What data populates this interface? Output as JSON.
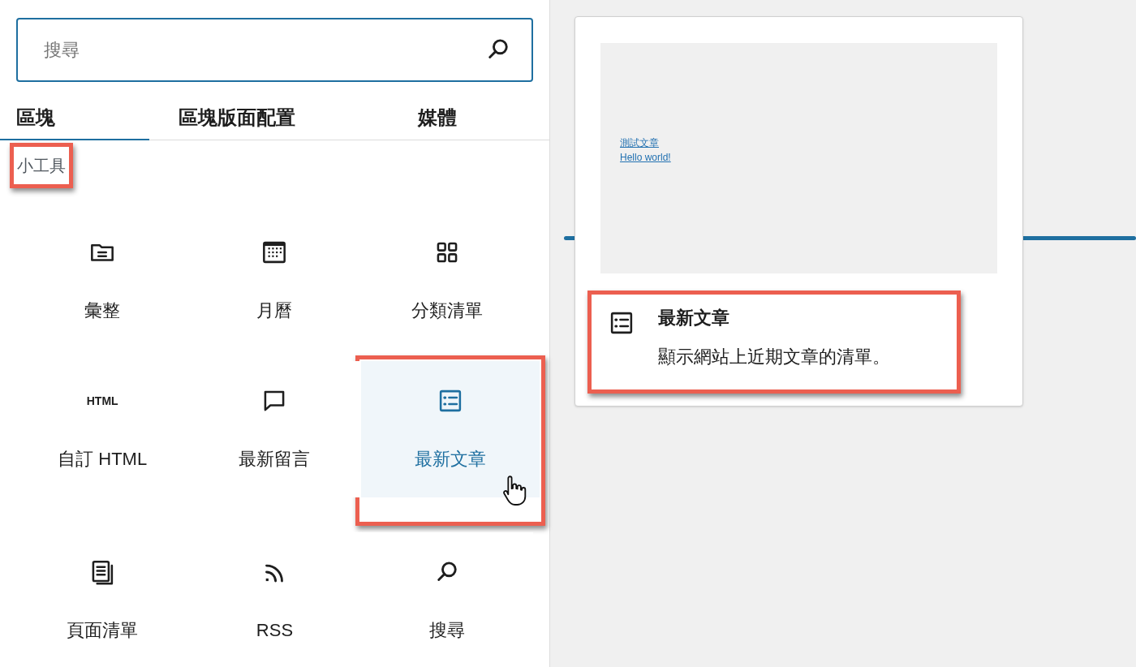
{
  "search": {
    "placeholder": "搜尋"
  },
  "tabs": [
    {
      "label": "區塊",
      "selected": true
    },
    {
      "label": "區塊版面配置",
      "selected": false
    },
    {
      "label": "媒體",
      "selected": false
    }
  ],
  "section": {
    "title": "小工具",
    "annotated": true
  },
  "blocks": [
    {
      "kind": "archive",
      "label": "彙整",
      "selected": false,
      "annotated": false
    },
    {
      "kind": "calendar",
      "label": "月曆",
      "selected": false,
      "annotated": false
    },
    {
      "kind": "categories",
      "label": "分類清單",
      "selected": false,
      "annotated": false
    },
    {
      "kind": "html",
      "icon_text": "HTML",
      "label": "自訂 HTML",
      "selected": false,
      "annotated": false
    },
    {
      "kind": "comments",
      "label": "最新留言",
      "selected": false,
      "annotated": false
    },
    {
      "kind": "posts",
      "label": "最新文章",
      "selected": true,
      "annotated": true
    },
    {
      "kind": "pages",
      "label": "頁面清單",
      "selected": false,
      "annotated": false
    },
    {
      "kind": "rss",
      "label": "RSS",
      "selected": false,
      "annotated": false
    },
    {
      "kind": "search",
      "label": "搜尋",
      "selected": false,
      "annotated": false
    }
  ],
  "preview": {
    "links": [
      "測試文章",
      "Hello world!"
    ],
    "title": "最新文章",
    "description": "顯示網站上近期文章的清單。",
    "annotated": true
  }
}
